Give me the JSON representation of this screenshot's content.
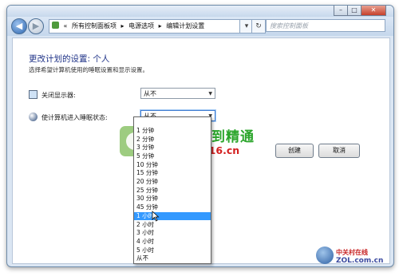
{
  "address": {
    "prefix": "«",
    "crumbs": [
      "所有控制面板项",
      "电源选项",
      "编辑计划设置"
    ],
    "separator": "▸"
  },
  "search": {
    "placeholder": "搜索控制面板"
  },
  "page": {
    "heading": "更改计划的设置: 个人",
    "subheading": "选择希望计算机使用的睡眠设置和显示设置。"
  },
  "settings": {
    "display_off_label": "关闭显示器:",
    "display_off_value": "从不",
    "sleep_label": "使计算机进入睡眠状态:",
    "sleep_value": "从不"
  },
  "buttons": {
    "save": "创建",
    "cancel": "取消"
  },
  "dropdown": {
    "options": [
      "1 分钟",
      "2 分钟",
      "3 分钟",
      "5 分钟",
      "10 分钟",
      "15 分钟",
      "20 分钟",
      "25 分钟",
      "30 分钟",
      "45 分钟",
      "1 小时",
      "2 小时",
      "3 小时",
      "4 小时",
      "5 小时",
      "从不"
    ],
    "selected_index": 10
  },
  "watermark": {
    "title": "电脑入门到精通",
    "url": "www.58116.cn",
    "brand_cn": "中关村在线",
    "brand_en": "ZOL.com.cn"
  },
  "colors": {
    "heading": "#1e3287",
    "selection": "#3399ff",
    "watermark_green": "#2aa52a",
    "watermark_red": "#d42020"
  }
}
